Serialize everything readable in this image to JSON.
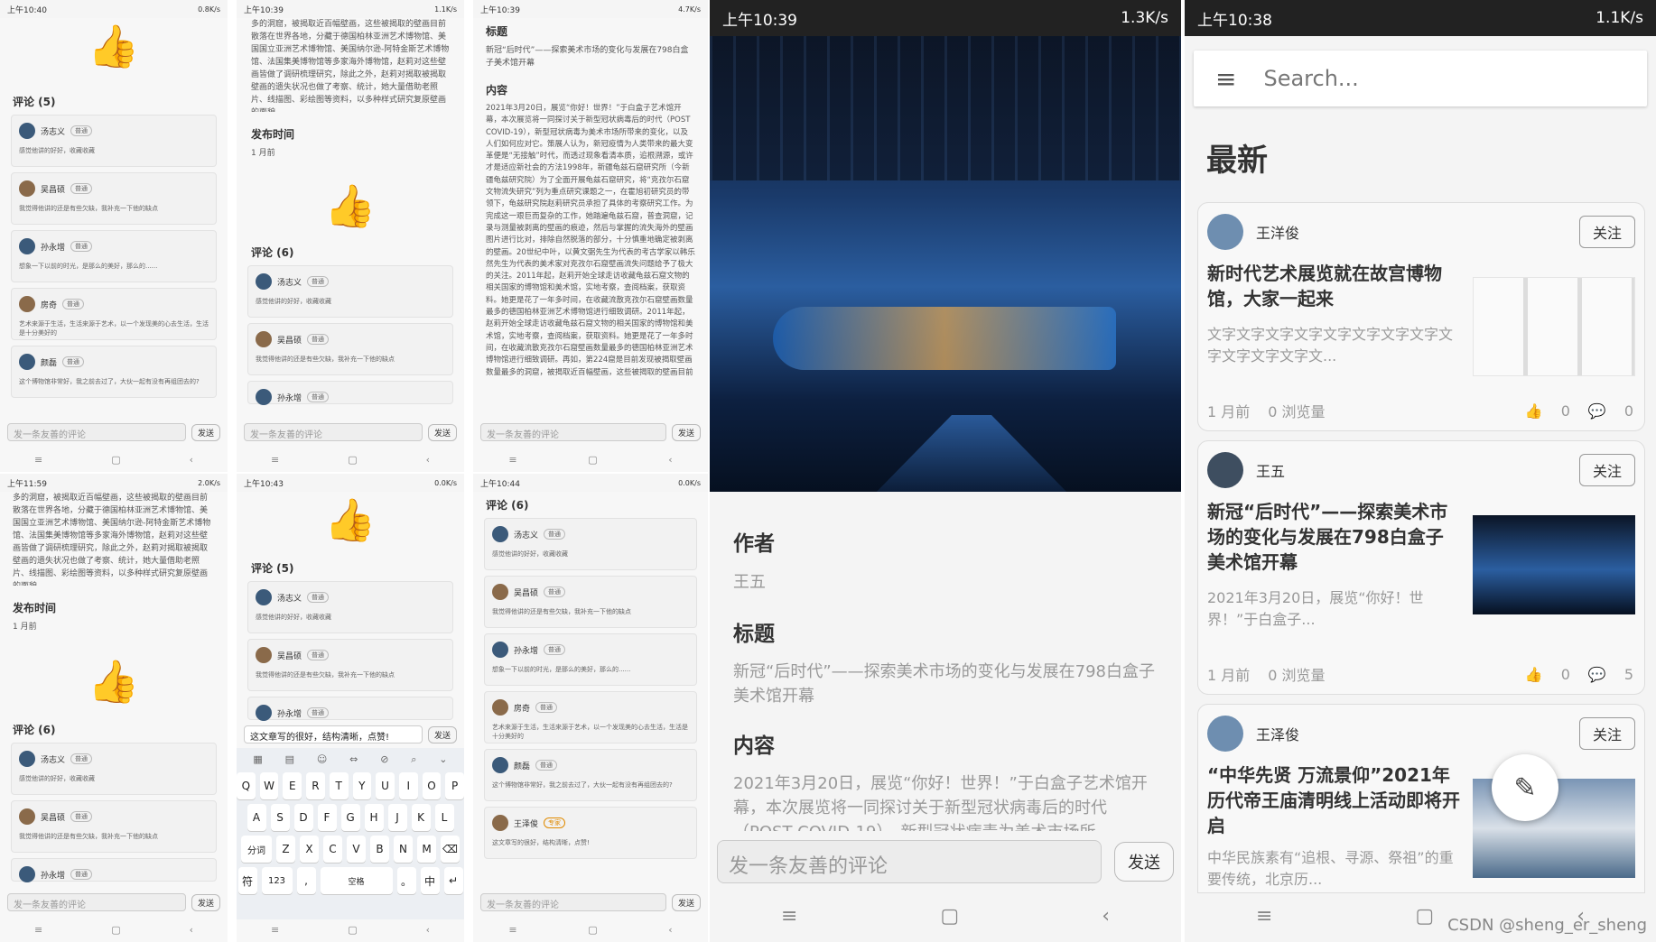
{
  "status": {
    "t1": "上午10:40",
    "t2": "上午10:39",
    "t3": "上午10:39",
    "t4": "上午11:59",
    "t5": "上午10:43",
    "t6": "上午10:44",
    "tb1": "上午10:39",
    "tb2": "上午10:38",
    "s1": "0.8K/s",
    "s2": "1.1K/s",
    "s3": "4.7K/s",
    "s4": "2.0K/s",
    "s5": "0.0K/s",
    "s6": "0.0K/s",
    "sb1": "1.3K/s",
    "sb2": "1.1K/s"
  },
  "labels": {
    "comments5": "评论 (5)",
    "comments6": "评论 (6)",
    "pubtime": "发布时间",
    "month": "1 月前",
    "title": "标题",
    "content": "内容",
    "author": "作者"
  },
  "article_para": "多的洞窟，被揭取近百幅壁画，这些被揭取的壁画目前散落在世界各地，分藏于德国柏林亚洲艺术博物馆、美国国立亚洲艺术博物馆、美国纳尔逊-阿特金斯艺术博物馆、法国集美博物馆等多家海外博物馆，赵莉对这些壁画皆做了调研梳理研究，除此之外，赵莉对揭取被揭取壁画的遗失状况也做了考察、统计，她大量借助老照片、线描图、彩绘图等资料，以多种样式研究复原壁画的面貌。",
  "article_title": "新冠“后时代”——探索美术市场的变化与发展在798白盒子美术馆开幕",
  "article_long": "2021年3月20日，展览“你好！世界！”于白盒子艺术馆开幕，本次展览将一同探讨关于新型冠状病毒后的时代（POST COVID-19），新型冠状病毒为美术市场所带来的变化，以及人们如何应对它。策展人认为，新冠疫情为人类带来的最大变革便是“无接触”时代，而透过现象看清本质，追根溯源，或许才是适应新社会的方法1998年，新疆龟兹石窟研究所（今新疆龟兹研究院）为了全面开展龟兹石窟研究，将“克孜尔石窟文物流失研究”列为重点研究课题之一，在霍旭初研究员的带领下，龟兹研究院赵莉研究员承担了具体的考察研究工作。为完成这一艰巨而复杂的工作，她踏遍龟兹石窟，普查洞窟，记录与测量被剥离的壁画的痕迹，然后与掌握的流失海外的壁画图片进行比对，排除自然脱落的部分，十分慎重地确定被剥离的壁画。20世纪中叶，以黄文弼先生为代表的考古学家以韩乐然先生为代表的美术家对克孜尔石窟壁画流失问题给予了极大的关注。2011年起，赵莉开始全球走访收藏龟兹石窟文物的相关国家的博物馆和美术馆，实地考察，查阅档案，获取资料。她更是花了一年多时间，在收藏流散克孜尔石窟壁画数量最多的德国柏林亚洲艺术博物馆进行细致调研。2011年起，赵莉开始全球走访收藏龟兹石窟文物的相关国家的博物馆和美术馆，实地考察，查阅档案，获取资料。她更是花了一年多时间，在收藏流散克孜尔石窟壁画数量最多的德国柏林亚洲艺术博物馆进行细致调研。再如，第224窟是目前发现被揭取壁画数量最多的洞窟，被揭取近百幅壁画，这些被揭取的壁画目前",
  "comments": [
    {
      "name": "汤志义",
      "tag": "普通",
      "text": "感觉他讲的好好，收藏收藏"
    },
    {
      "name": "吴昌硕",
      "tag": "普通",
      "text": "我觉得他讲的还是有些欠缺，我补充一下他的缺点"
    },
    {
      "name": "孙永增",
      "tag": "普通",
      "text": "想象一下以前的时光，是那么的美好，那么的......"
    },
    {
      "name": "房奇",
      "tag": "普通",
      "text": "艺术来源于生活，生活来源于艺术，以一个发现美的心去生活，生活是十分美好的"
    },
    {
      "name": "颜磊",
      "tag": "普通",
      "text": "这个博物馆非常好，我之前去过了，大伙一起有没有再组团去的?"
    },
    {
      "name": "王泽俊",
      "tag": "专家",
      "text": "这文章写的很好，结构清晰，点赞!"
    }
  ],
  "comment_placeholder": "发一条友善的评论",
  "send": "发送",
  "draft": "这文章写的很好，结构清晰，点赞!",
  "keyboard": {
    "row1": [
      "Q",
      "W",
      "E",
      "R",
      "T",
      "Y",
      "U",
      "I",
      "O",
      "P"
    ],
    "row2": [
      "A",
      "S",
      "D",
      "F",
      "G",
      "H",
      "J",
      "K",
      "L"
    ],
    "row3": [
      "分词",
      "Z",
      "X",
      "C",
      "V",
      "B",
      "N",
      "M",
      "⌫"
    ],
    "row4": [
      "符",
      "123",
      ",",
      "空格",
      "。",
      "中",
      "↵"
    ]
  },
  "detail": {
    "author": "王五",
    "title": "新冠“后时代”——探索美术市场的变化与发展在798白盒子美术馆开幕",
    "content": "2021年3月20日，展览“你好！世界！”于白盒子艺术馆开幕，本次展览将一同探讨关于新型冠状病毒后的时代（POST COVID-19），新型冠状病毒为美术市场所"
  },
  "feed": {
    "search": "Search...",
    "heading": "最新",
    "follow": "关注",
    "items": [
      {
        "user": "王洋俊",
        "title": "新时代艺术展览就在故宫博物馆，大家一起来",
        "summary": "文字文字文字文字文字文字文字文字文字文字文字文字文...",
        "time": "1 月前",
        "views": "0 浏览量",
        "likes": "0",
        "comments": "0"
      },
      {
        "user": "王五",
        "title": "新冠“后时代”——探索美术市场的变化与发展在798白盒子美术馆开幕",
        "summary": "2021年3月20日，展览“你好！世界！”于白盒子...",
        "time": "1 月前",
        "views": "0 浏览量",
        "likes": "0",
        "comments": "5"
      },
      {
        "user": "王泽俊",
        "title": "“中华先贤 万流景仰”2021年历代帝王庙清明线上活动即将开启",
        "summary": "中华民族素有“追根、寻源、祭祖”的重要传统，北京历..."
      }
    ]
  },
  "watermark": "CSDN @sheng_er_sheng",
  "colors": {
    "accent": "#2e86de",
    "expert": "#e08a00"
  }
}
